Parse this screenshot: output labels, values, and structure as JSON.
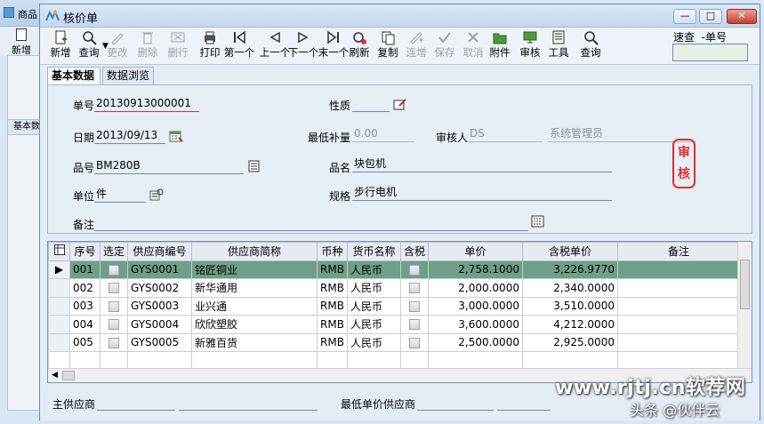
{
  "background_window": {
    "title": "商品",
    "new_label": "新增",
    "tab_label": "基本数"
  },
  "window": {
    "title": "核价单",
    "min_glyph": "—",
    "max_glyph": "□",
    "close_glyph": "✕"
  },
  "toolbar": {
    "items": [
      {
        "label": "新增",
        "icon": "new-doc-icon",
        "enabled": true
      },
      {
        "label": "查询",
        "icon": "search-icon",
        "enabled": true
      },
      {
        "label": "更改",
        "icon": "pencil-icon",
        "enabled": false
      },
      {
        "label": "删除",
        "icon": "trash-icon",
        "enabled": false
      },
      {
        "label": "删行",
        "icon": "delete-row-icon",
        "enabled": false
      },
      {
        "label": "打印",
        "icon": "printer-icon",
        "enabled": true
      },
      {
        "label": "第一个",
        "icon": "first-icon",
        "enabled": true
      },
      {
        "label": "上一个",
        "icon": "previous-icon",
        "enabled": true
      },
      {
        "label": "下一个",
        "icon": "next-icon",
        "enabled": true
      },
      {
        "label": "末一个",
        "icon": "last-icon",
        "enabled": true
      },
      {
        "label": "刷新",
        "icon": "refresh-icon",
        "enabled": true
      },
      {
        "label": "复制",
        "icon": "copy-icon",
        "enabled": true
      },
      {
        "label": "连增",
        "icon": "continuous-add-icon",
        "enabled": false
      },
      {
        "label": "保存",
        "icon": "check-icon",
        "enabled": false
      },
      {
        "label": "取消",
        "icon": "cancel-icon",
        "enabled": false
      },
      {
        "label": "附件",
        "icon": "folder-icon",
        "enabled": true
      },
      {
        "label": "审核",
        "icon": "audit-icon",
        "enabled": true
      },
      {
        "label": "工具",
        "icon": "tools-icon",
        "enabled": true
      },
      {
        "label": "查询",
        "icon": "magnifier-icon",
        "enabled": true
      }
    ],
    "quick_search_label": "速查",
    "quick_search_field": "-单号",
    "quick_search_value": ""
  },
  "tabs": [
    {
      "label": "基本数据",
      "active": true
    },
    {
      "label": "数据浏览",
      "active": false
    }
  ],
  "form": {
    "order_no_label": "单号",
    "order_no": "20130913000001",
    "date_label": "日期",
    "date": "2013/09/13",
    "item_no_label": "品号",
    "item_no": "BM280B",
    "unit_label": "单位",
    "unit": "件",
    "remark_label": "备注",
    "remark": "",
    "nature_label": "性质",
    "nature": "",
    "min_replenish_label": "最低补量",
    "min_replenish": "0.00",
    "auditor_label": "审核人",
    "auditor_code": "DS",
    "auditor_name": "系统管理员",
    "item_name_label": "品名",
    "item_name": "块包机",
    "spec_label": "规格",
    "spec": "步行电机",
    "audit_stamp": "审核"
  },
  "grid": {
    "columns": [
      "序号",
      "选定",
      "供应商编号",
      "供应商简称",
      "币种",
      "货币名称",
      "含税",
      "单价",
      "含税单价",
      "备注"
    ],
    "rows": [
      {
        "seq": "001",
        "vendor_no": "GYS0001",
        "vendor": "铭匠铜业",
        "currency": "RMB",
        "currency_name": "人民币",
        "price": "2,758.1000",
        "tax_price": "3,226.9770",
        "remark": "",
        "selected": true
      },
      {
        "seq": "002",
        "vendor_no": "GYS0002",
        "vendor": "新华通用",
        "currency": "RMB",
        "currency_name": "人民币",
        "price": "2,000.0000",
        "tax_price": "2,340.0000",
        "remark": "",
        "selected": false
      },
      {
        "seq": "003",
        "vendor_no": "GYS0003",
        "vendor": "业兴通",
        "currency": "RMB",
        "currency_name": "人民币",
        "price": "3,000.0000",
        "tax_price": "3,510.0000",
        "remark": "",
        "selected": false
      },
      {
        "seq": "004",
        "vendor_no": "GYS0004",
        "vendor": "欣欣塑胶",
        "currency": "RMB",
        "currency_name": "人民币",
        "price": "3,600.0000",
        "tax_price": "4,212.0000",
        "remark": "",
        "selected": false
      },
      {
        "seq": "005",
        "vendor_no": "GYS0005",
        "vendor": "新雅百货",
        "currency": "RMB",
        "currency_name": "人民币",
        "price": "2,500.0000",
        "tax_price": "2,925.0000",
        "remark": "",
        "selected": false
      }
    ]
  },
  "footer": {
    "main_vendor_label": "主供应商",
    "main_vendor": "",
    "lowest_price_vendor_label": "最低单价供应商",
    "lowest_price_vendor": ""
  },
  "watermark": {
    "line1": "www.rjtj.cn软荐网",
    "line2": "头条 @伙伴云"
  },
  "colors": {
    "selected_row": "#6f9f86",
    "audit_stamp": "#e03030",
    "title_bar": "#c3d7ef"
  }
}
